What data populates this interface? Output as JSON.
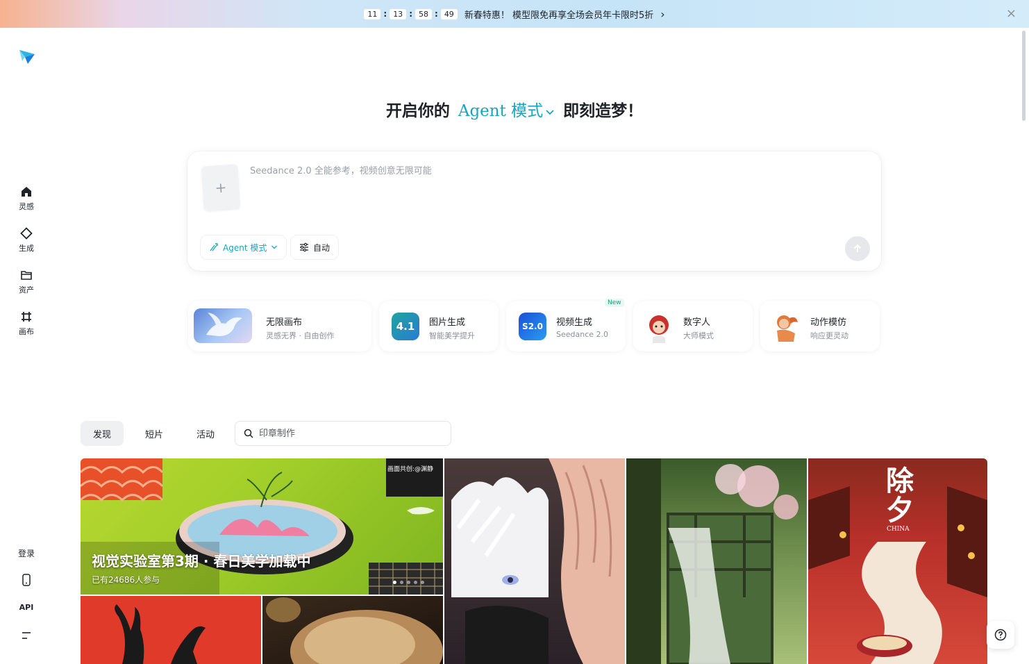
{
  "promo": {
    "timer": {
      "h": "11",
      "m": "13",
      "s": "58",
      "ms": "49"
    },
    "text": "新春特惠！ 模型限免再享全场会员年卡限时5折",
    "arrow": "›",
    "close": "×"
  },
  "sidebar": {
    "items": [
      {
        "label": "灵感",
        "icon": "home-icon"
      },
      {
        "label": "生成",
        "icon": "diamond-icon"
      },
      {
        "label": "资产",
        "icon": "folder-icon"
      },
      {
        "label": "画布",
        "icon": "hash-frame-icon"
      }
    ],
    "login": "登录",
    "api": "API"
  },
  "hero": {
    "prefix": "开启你的",
    "mode": "Agent 模式",
    "suffix": "即刻造梦！"
  },
  "prompt": {
    "placeholder": "Seedance 2.0 全能参考，视频创意无限可能",
    "upload_plus": "+",
    "agent_chip": "Agent 模式",
    "auto_chip": "自动"
  },
  "tools": [
    {
      "title": "无限画布",
      "subtitle": "灵感无界 · 自由创作"
    },
    {
      "title": "图片生成",
      "subtitle": "智能美学提升",
      "thumb_text": "4.1"
    },
    {
      "title": "视频生成",
      "subtitle": "Seedance 2.0",
      "thumb_text": "S2.0",
      "badge": "New"
    },
    {
      "title": "数字人",
      "subtitle": "大师模式"
    },
    {
      "title": "动作模仿",
      "subtitle": "响应更灵动"
    }
  ],
  "feed": {
    "tabs": [
      "发现",
      "短片",
      "活动"
    ],
    "active_tab": "发现",
    "search_placeholder": "印章制作"
  },
  "banner": {
    "title": "视觉实验室第3期 · 春日美学加载中",
    "subtitle": "已有24686人参与",
    "credit": "画面共创:@渊静"
  },
  "gallery": {
    "poster_title": "除夕",
    "poster_sub": "CHINA"
  },
  "colors": {
    "accent": "#16a5c3",
    "text": "#1f2329",
    "muted": "#8a9099"
  }
}
